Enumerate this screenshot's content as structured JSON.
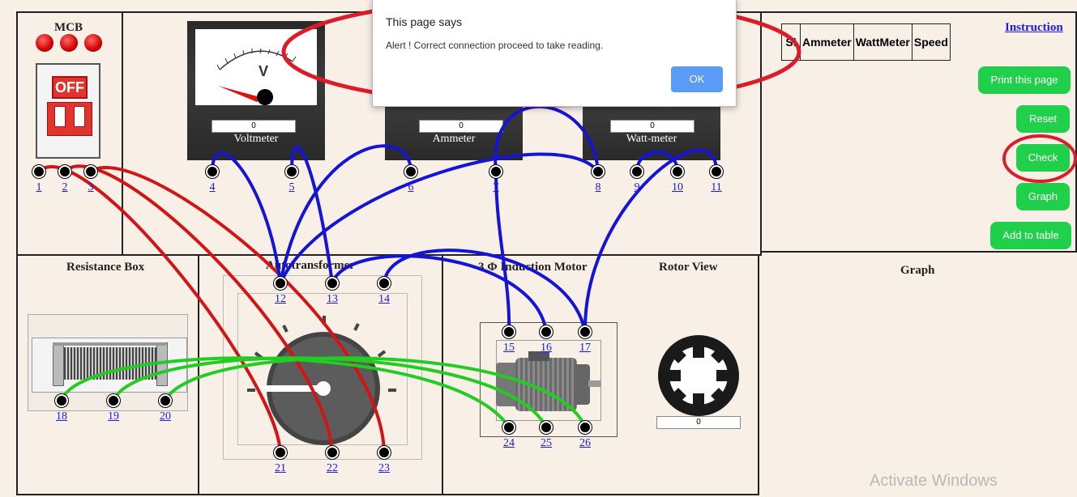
{
  "mcb": {
    "title": "MCB",
    "switch_label": "OFF"
  },
  "meters": {
    "voltmeter": {
      "name": "Voltmeter",
      "reading": "0",
      "dial_letter": "V"
    },
    "ammeter": {
      "name": "Ammeter",
      "reading": "0"
    },
    "wattmeter": {
      "name": "Watt-meter",
      "reading": "0"
    }
  },
  "panels": {
    "resistance_box": "Resistance Box",
    "autotransformer": "Autotransformer",
    "motor": "3 Φ Induction Motor",
    "rotor_view": "Rotor View",
    "graph": "Graph"
  },
  "rotor_speed": "0",
  "terminals": [
    "1",
    "2",
    "3",
    "4",
    "5",
    "6",
    "7",
    "8",
    "9",
    "10",
    "11",
    "12",
    "13",
    "14",
    "15",
    "16",
    "17",
    "18",
    "19",
    "20",
    "21",
    "22",
    "23",
    "24",
    "25",
    "26"
  ],
  "table_headers": [
    "Sl",
    "Ammeter",
    "WattMeter",
    "Speed"
  ],
  "links": {
    "instruction": "Instruction"
  },
  "buttons": {
    "print": "Print this page",
    "reset": "Reset",
    "check": "Check",
    "graph": "Graph",
    "add_to_table": "Add to table"
  },
  "dialog": {
    "title": "This page says",
    "message": "Alert ! Correct connection proceed to take reading.",
    "ok": "OK"
  },
  "watermark": "Activate Windows",
  "colors": {
    "wire_red": "#d41414",
    "wire_blue": "#1414d8",
    "wire_green": "#22cc22",
    "button_green": "#21d04a",
    "annotation_red": "#dd1c2a"
  }
}
